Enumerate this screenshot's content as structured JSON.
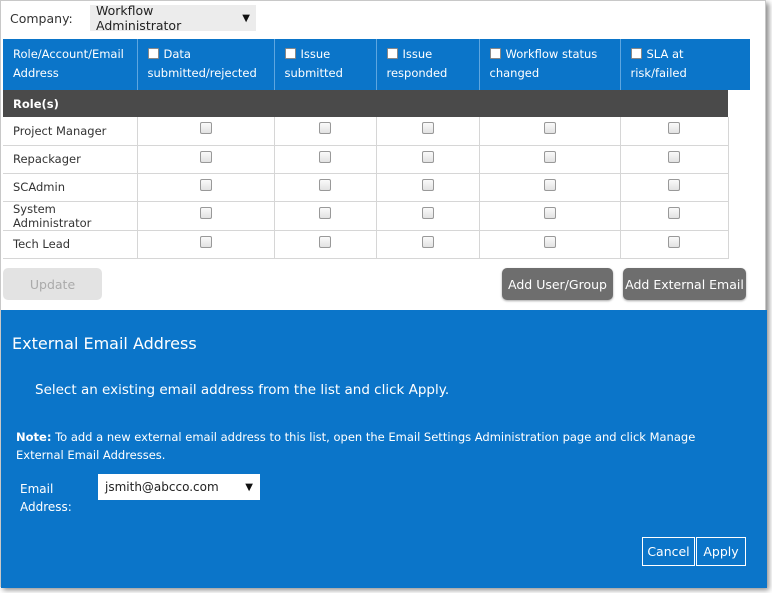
{
  "company": {
    "label": "Company:",
    "selected": "Workflow Administrator"
  },
  "table": {
    "first_header": "Role/Account/Email Address",
    "columns": [
      "Data submitted/rejected",
      "Issue submitted",
      "Issue responded",
      "Workflow status changed",
      "SLA at risk/failed"
    ],
    "section": "Role(s)",
    "rows": [
      {
        "name": "Project Manager"
      },
      {
        "name": "Repackager"
      },
      {
        "name": "SCAdmin"
      },
      {
        "name": "System Administrator"
      },
      {
        "name": "Tech Lead"
      }
    ]
  },
  "buttons": {
    "update": "Update",
    "add_user_group": "Add User/Group",
    "add_external_email": "Add External Email"
  },
  "dialog": {
    "title": "External Email Address",
    "instruction": "Select an existing email address from the list and click Apply.",
    "note_label": "Note:",
    "note_text": " To add a new external email address to this list, open the Email Settings Administration page and click Manage External Email Addresses.",
    "email_label": "Email Address:",
    "email_selected": "jsmith@abcco.com",
    "cancel": "Cancel",
    "apply": "Apply"
  },
  "colors": {
    "accent": "#0b75c9",
    "section_bar": "#4a4a4a",
    "dark_button": "#6e6e6e"
  }
}
